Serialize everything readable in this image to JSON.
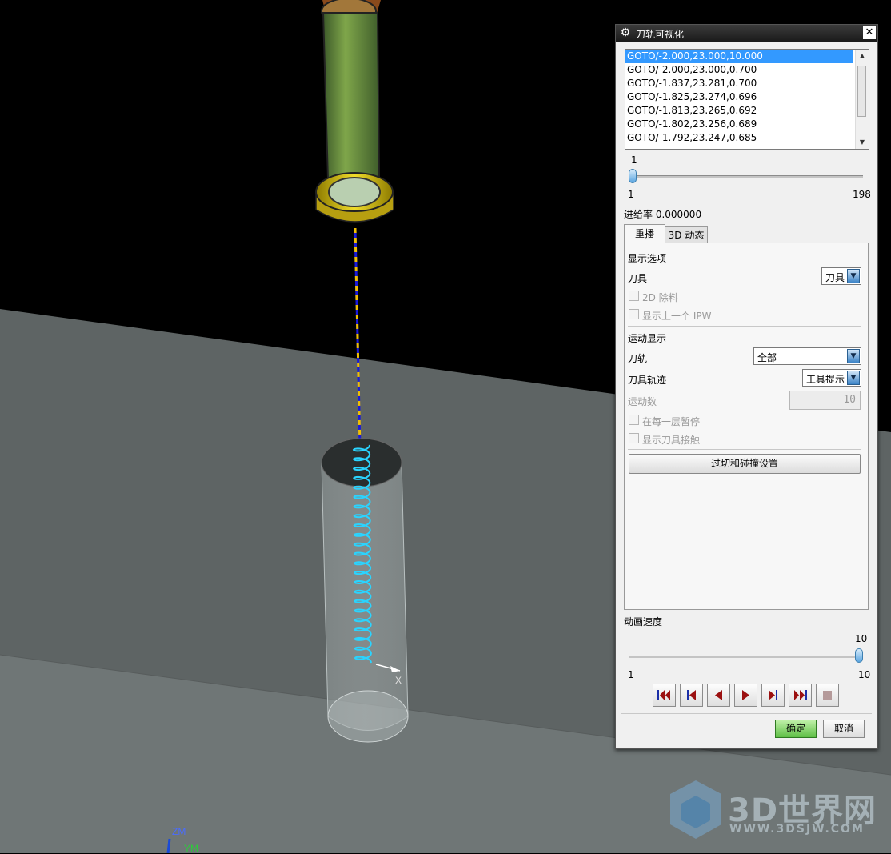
{
  "viewport": {
    "axis_x": "X",
    "axis_zm": "ZM",
    "axis_ym": "YM"
  },
  "dialog": {
    "title": "刀轨可视化",
    "icon": "gear-icon",
    "close_icon": "close-icon",
    "path_list": [
      "GOTO/-2.000,23.000,10.000",
      "GOTO/-2.000,23.000,0.700",
      "GOTO/-1.837,23.281,0.700",
      "GOTO/-1.825,23.274,0.696",
      "GOTO/-1.813,23.265,0.692",
      "GOTO/-1.802,23.256,0.689",
      "GOTO/-1.792,23.247,0.685"
    ],
    "selected_index": 0,
    "step_slider": {
      "value": "1",
      "min": "1",
      "max": "198",
      "fraction": 0.0
    },
    "feed_rate_label": "进给率 0.000000",
    "tabs": [
      "重播",
      "3D 动态"
    ],
    "active_tab": 0,
    "display_options": {
      "section": "显示选项",
      "tool_label": "刀具",
      "tool_value": "刀具",
      "opt_2d": "2D 除料",
      "opt_ipw": "显示上一个 IPW"
    },
    "motion_display": {
      "section": "运动显示",
      "path_label": "刀轨",
      "path_value": "全部",
      "trace_label": "刀具轨迹",
      "trace_value": "工具提示",
      "motion_count_label": "运动数",
      "motion_count_value": "10",
      "pause_each_layer": "在每一层暂停",
      "show_contact": "显示刀具接触"
    },
    "gouge_button": "过切和碰撞设置",
    "anim_speed": {
      "label": "动画速度",
      "value": "10",
      "min": "1",
      "max": "10",
      "fraction": 1.0
    },
    "ok": "确定",
    "cancel": "取消"
  },
  "watermark": {
    "title": "3D世界网",
    "subtitle": "WWW.3DSJW.COM"
  },
  "colors": {
    "ground": "#5f6565",
    "background": "#000000",
    "helix": "#2ad4ff",
    "accent_blue": "#3399ff"
  }
}
